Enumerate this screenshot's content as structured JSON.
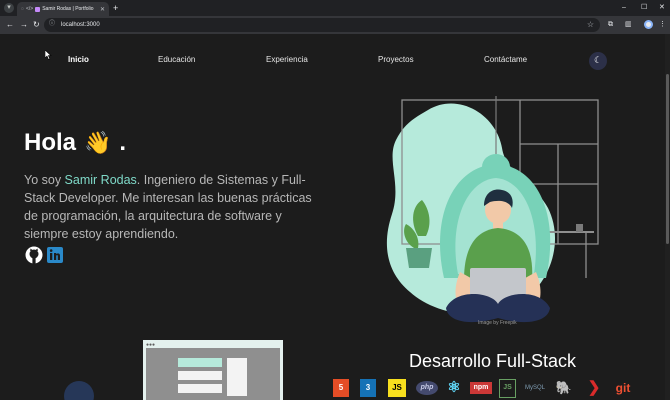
{
  "browser": {
    "tab_title": "Samir Rodas | Portfolio",
    "url": "localhost:3000",
    "new_tab": "+",
    "controls": [
      "–",
      "☐",
      "✕"
    ]
  },
  "nav": {
    "items": [
      "Inicio",
      "Educación",
      "Experiencia",
      "Proyectos",
      "Contáctame"
    ],
    "active": "Inicio",
    "theme_icon": "moon-icon"
  },
  "hero": {
    "greeting": "Hola",
    "greeting_suffix": ".",
    "intro_prefix": "Yo soy ",
    "name": "Samir Rodas",
    "intro_suffix": ". Ingeniero de Sistemas y Full-Stack Developer. Me interesan las buenas prácticas de programación, la arquitectura de software y siempre estoy aprendiendo.",
    "social": [
      "github-icon",
      "linkedin-icon"
    ],
    "image_credit": "Image by Freepik"
  },
  "fullstack": {
    "title": "Desarrollo Full-Stack",
    "tech": [
      "5",
      "3",
      "JS",
      "php",
      "⚛",
      "npm",
      "JS",
      "MySQL",
      "🐘",
      "❯",
      "git"
    ]
  },
  "colors": {
    "background": "#1c1c1c",
    "accent": "#7fd9c8",
    "illustration_mint": "#b6eadb",
    "illustration_teal": "#78d2b8",
    "shirt": "#5aa04c",
    "pants": "#253156"
  }
}
